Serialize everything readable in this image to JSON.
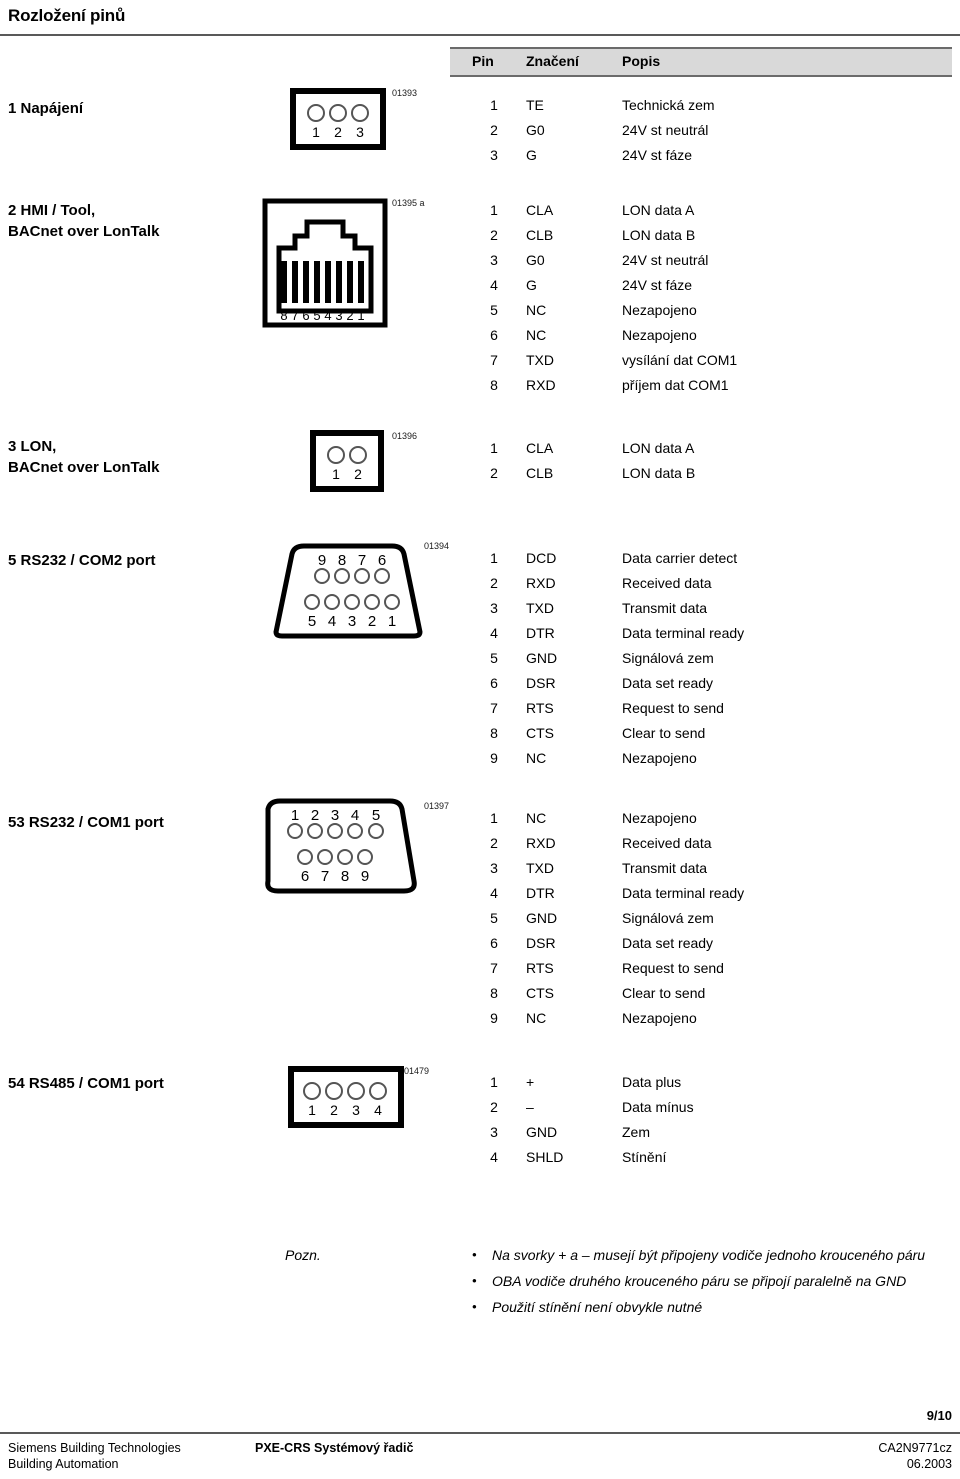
{
  "header": {
    "title": "Rozložení pinů"
  },
  "table_header": {
    "pin": "Pin",
    "signal": "Značení",
    "description": "Popis"
  },
  "sections": [
    {
      "title": "1 Napájení",
      "connector_code": "01393",
      "connector_type": "terminal-3",
      "pin_labels": [
        "1",
        "2",
        "3"
      ],
      "rows": [
        {
          "pin": "1",
          "signal": "TE",
          "desc": "Technická zem"
        },
        {
          "pin": "2",
          "signal": "G0",
          "desc": "24V st neutrál"
        },
        {
          "pin": "3",
          "signal": "G",
          "desc": "24V st fáze"
        }
      ]
    },
    {
      "title": "2 HMI / Tool,\nBACnet over LonTalk",
      "connector_code": "01395 a",
      "connector_type": "rj45",
      "pin_labels": [
        "8",
        "7",
        "6",
        "5",
        "4",
        "3",
        "2",
        "1"
      ],
      "rows": [
        {
          "pin": "1",
          "signal": "CLA",
          "desc": "LON data A"
        },
        {
          "pin": "2",
          "signal": "CLB",
          "desc": "LON data B"
        },
        {
          "pin": "3",
          "signal": "G0",
          "desc": "24V st neutrál"
        },
        {
          "pin": "4",
          "signal": "G",
          "desc": "24V st fáze"
        },
        {
          "pin": "5",
          "signal": "NC",
          "desc": "Nezapojeno"
        },
        {
          "pin": "6",
          "signal": "NC",
          "desc": "Nezapojeno"
        },
        {
          "pin": "7",
          "signal": "TXD",
          "desc": "vysílání dat COM1"
        },
        {
          "pin": "8",
          "signal": "RXD",
          "desc": "příjem dat COM1"
        }
      ]
    },
    {
      "title": "3 LON,\nBACnet over LonTalk",
      "connector_code": "01396",
      "connector_type": "terminal-2",
      "pin_labels": [
        "1",
        "2"
      ],
      "rows": [
        {
          "pin": "1",
          "signal": "CLA",
          "desc": "LON data A"
        },
        {
          "pin": "2",
          "signal": "CLB",
          "desc": "LON data B"
        }
      ]
    },
    {
      "title": "5 RS232 / COM2  port",
      "connector_code": "01394",
      "connector_type": "db9-female",
      "pin_labels_top": [
        "9",
        "8",
        "7",
        "6"
      ],
      "pin_labels_bottom": [
        "5",
        "4",
        "3",
        "2",
        "1"
      ],
      "rows": [
        {
          "pin": "1",
          "signal": "DCD",
          "desc": "Data carrier detect"
        },
        {
          "pin": "2",
          "signal": "RXD",
          "desc": "Received data"
        },
        {
          "pin": "3",
          "signal": "TXD",
          "desc": "Transmit data"
        },
        {
          "pin": "4",
          "signal": "DTR",
          "desc": "Data terminal ready"
        },
        {
          "pin": "5",
          "signal": "GND",
          "desc": "Signálová zem"
        },
        {
          "pin": "6",
          "signal": "DSR",
          "desc": "Data set ready"
        },
        {
          "pin": "7",
          "signal": "RTS",
          "desc": "Request to send"
        },
        {
          "pin": "8",
          "signal": "CTS",
          "desc": "Clear to send"
        },
        {
          "pin": "9",
          "signal": "NC",
          "desc": "Nezapojeno"
        }
      ]
    },
    {
      "title": "53 RS232 / COM1  port",
      "connector_code": "01397",
      "connector_type": "db9-male",
      "pin_labels_top": [
        "1",
        "2",
        "3",
        "4",
        "5"
      ],
      "pin_labels_bottom": [
        "6",
        "7",
        "8",
        "9"
      ],
      "rows": [
        {
          "pin": "1",
          "signal": "NC",
          "desc": "Nezapojeno"
        },
        {
          "pin": "2",
          "signal": "RXD",
          "desc": "Received data"
        },
        {
          "pin": "3",
          "signal": "TXD",
          "desc": "Transmit data"
        },
        {
          "pin": "4",
          "signal": "DTR",
          "desc": "Data terminal ready"
        },
        {
          "pin": "5",
          "signal": "GND",
          "desc": "Signálová zem"
        },
        {
          "pin": "6",
          "signal": "DSR",
          "desc": "Data set ready"
        },
        {
          "pin": "7",
          "signal": "RTS",
          "desc": "Request to send"
        },
        {
          "pin": "8",
          "signal": "CTS",
          "desc": "Clear to send"
        },
        {
          "pin": "9",
          "signal": "NC",
          "desc": "Nezapojeno"
        }
      ]
    },
    {
      "title": "54 RS485 / COM1  port",
      "connector_code": "01479",
      "connector_type": "terminal-4",
      "pin_labels": [
        "1",
        "2",
        "3",
        "4"
      ],
      "rows": [
        {
          "pin": "1",
          "signal": "+",
          "desc": "Data plus"
        },
        {
          "pin": "2",
          "signal": "–",
          "desc": "Data mínus"
        },
        {
          "pin": "3",
          "signal": "GND",
          "desc": "Zem"
        },
        {
          "pin": "4",
          "signal": "SHLD",
          "desc": "Stínění"
        }
      ]
    }
  ],
  "notes": {
    "label": "Pozn.",
    "items": [
      "Na svorky + a – musejí být připojeny vodiče jednoho krouceného páru",
      "OBA vodiče druhého krouceného páru se připojí paralelně na GND",
      "Použití stínění není obvykle nutné"
    ]
  },
  "footer": {
    "page_number": "9/10",
    "company_line1": "Siemens Building Technologies",
    "company_line2": "Building Automation",
    "product": "PXE-CRS Systémový řadič",
    "doc_ref": "CA2N9771cz",
    "doc_date": "06.2003"
  }
}
